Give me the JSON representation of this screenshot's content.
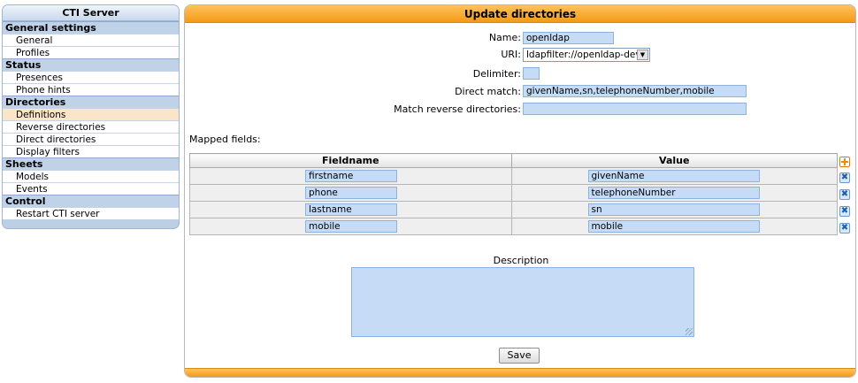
{
  "sidebar": {
    "title": "CTI Server",
    "sections": [
      {
        "label": "General settings",
        "items": [
          "General",
          "Profiles"
        ]
      },
      {
        "label": "Status",
        "items": [
          "Presences",
          "Phone hints"
        ]
      },
      {
        "label": "Directories",
        "items": [
          "Definitions",
          "Reverse directories",
          "Direct directories",
          "Display filters"
        ]
      },
      {
        "label": "Sheets",
        "items": [
          "Models",
          "Events"
        ]
      },
      {
        "label": "Control",
        "items": [
          "Restart CTI server"
        ]
      }
    ],
    "active_item": "Definitions"
  },
  "panel": {
    "title": "Update directories"
  },
  "form": {
    "name_label": "Name:",
    "name_value": "openldap",
    "uri_label": "URI:",
    "uri_value": "ldapfilter://openldap-dev",
    "delimiter_label": "Delimiter:",
    "delimiter_value": "",
    "direct_match_label": "Direct match:",
    "direct_match_value": "givenName,sn,telephoneNumber,mobile",
    "match_reverse_label": "Match reverse directories:",
    "match_reverse_value": ""
  },
  "mapped": {
    "label": "Mapped fields:",
    "col_fieldname": "Fieldname",
    "col_value": "Value",
    "rows": [
      {
        "fieldname": "firstname",
        "value": "givenName"
      },
      {
        "fieldname": "phone",
        "value": "telephoneNumber"
      },
      {
        "fieldname": "lastname",
        "value": "sn"
      },
      {
        "fieldname": "mobile",
        "value": "mobile"
      }
    ]
  },
  "description": {
    "label": "Description",
    "value": ""
  },
  "save_label": "Save",
  "icons": {
    "add": "add-icon",
    "delete": "delete-icon",
    "dropdown": "chevron-down-icon"
  },
  "colors": {
    "header_orange": "#f39a16",
    "input_blue": "#c6dcf6",
    "sidebar_blue": "#bccfe4",
    "active_item": "#fbe5c8"
  }
}
